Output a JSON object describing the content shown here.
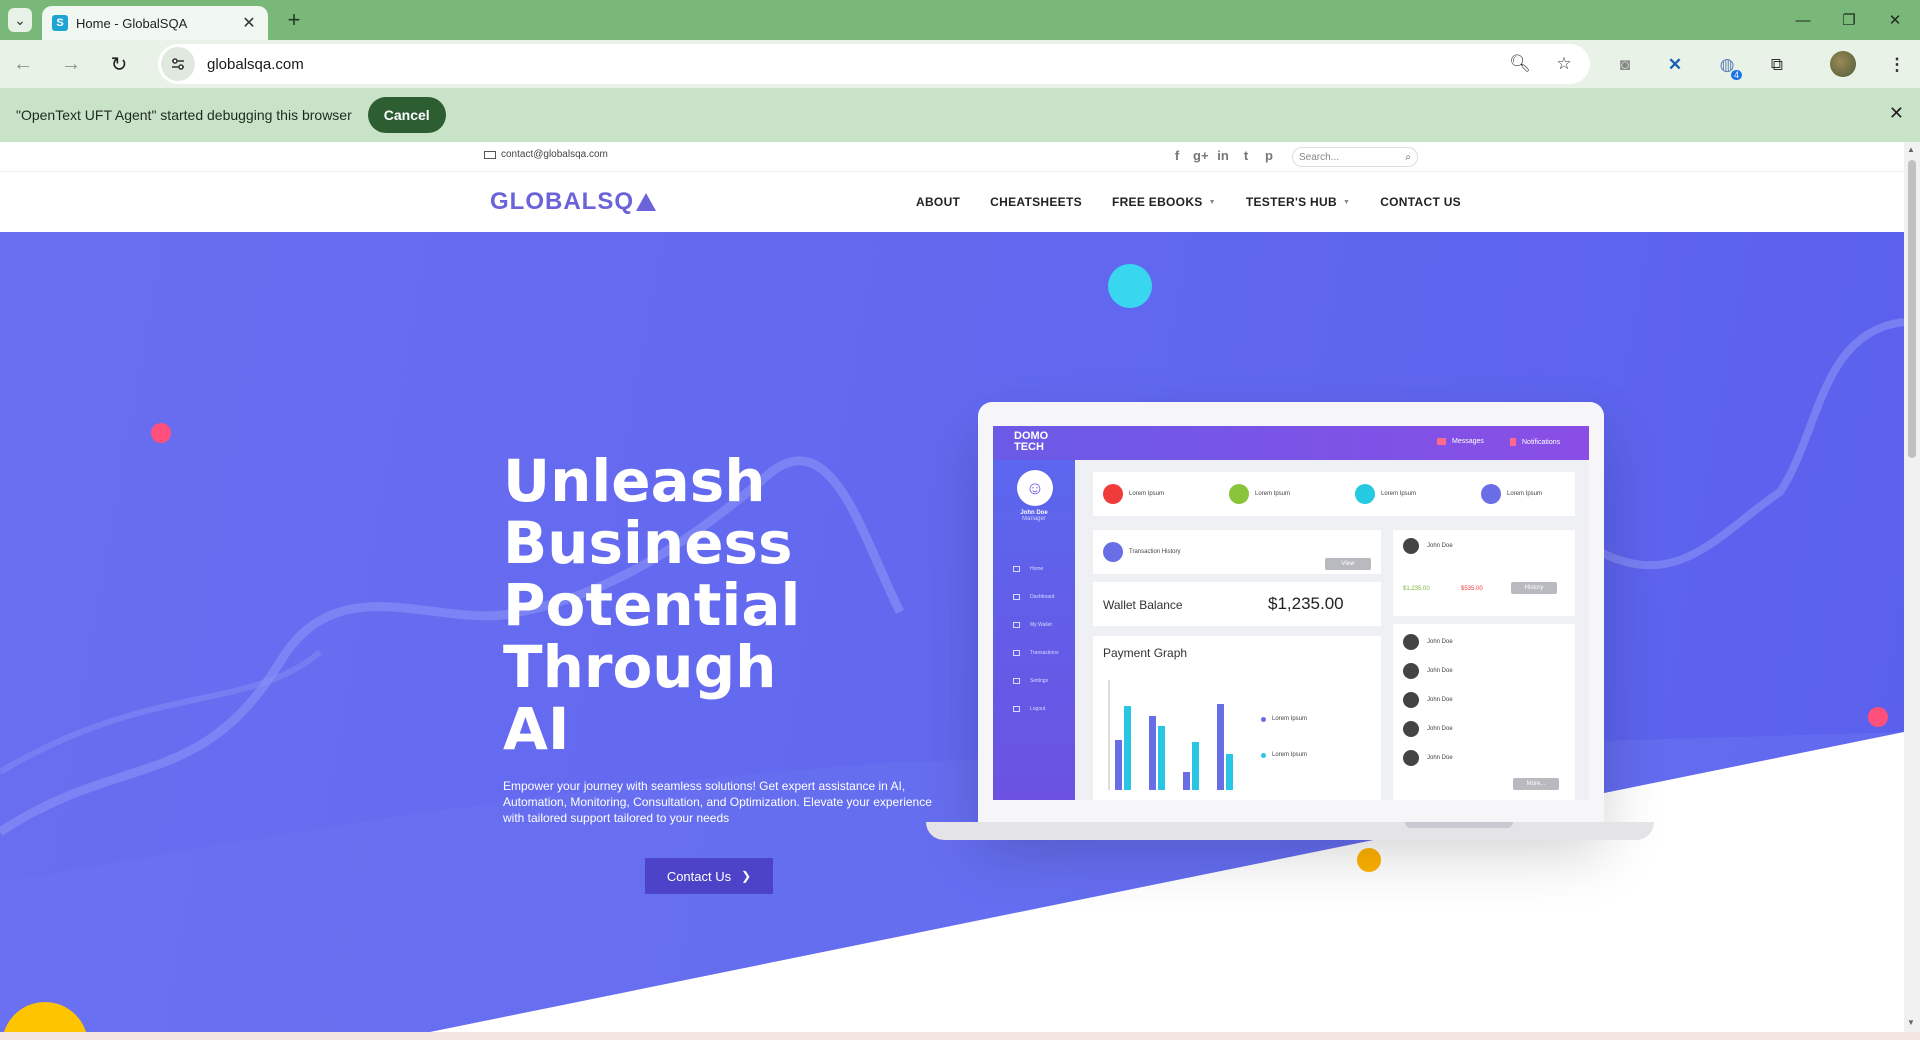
{
  "browser": {
    "tab_title": "Home - GlobalSQA",
    "favicon_letter": "S",
    "url": "globalsqa.com",
    "extension_badge": "4",
    "infobar_text": "\"OpenText UFT Agent\" started debugging this browser",
    "infobar_cancel": "Cancel"
  },
  "site": {
    "contact_email": "contact@globalsqa.com",
    "socials": [
      "f",
      "g+",
      "in",
      "t",
      "p"
    ],
    "search_placeholder": "Search...",
    "logo": "GLOBALSQ",
    "menu": [
      {
        "label": "ABOUT",
        "dropdown": false
      },
      {
        "label": "CHEATSHEETS",
        "dropdown": false
      },
      {
        "label": "FREE EBOOKS",
        "dropdown": true
      },
      {
        "label": "TESTER'S HUB",
        "dropdown": true
      },
      {
        "label": "CONTACT US",
        "dropdown": false
      }
    ]
  },
  "hero": {
    "title_lines": [
      "Unleash",
      "Business",
      "Potential",
      "Through",
      "AI"
    ],
    "description": "Empower your journey with seamless solutions! Get expert assistance in AI, Automation, Monitoring, Consultation, and Optimization. Elevate your experience with tailored support tailored to your needs",
    "cta": "Contact Us",
    "colors": {
      "hero_bg": "#6168ef",
      "cta_bg": "#4c43c8",
      "dot_pink": "#ff4f7b",
      "dot_cyan": "#38d6ef",
      "dot_yellow": "#ffb300"
    }
  },
  "dashboard": {
    "logo_line1": "DOMO",
    "logo_line2": "TECH",
    "messages": "Messages",
    "notifications": "Notifications",
    "user_name": "John Doe",
    "user_role": "Manager",
    "nav": [
      "Home",
      "Dashboard",
      "My Wallet",
      "Transactions",
      "Settings",
      "Logout"
    ],
    "lorem": "Lorem Ipsum",
    "transaction_history": "Transaction History",
    "view": "View",
    "wallet_label": "Wallet Balance",
    "wallet_value": "$1,235.00",
    "payment_graph": "Payment Graph",
    "in_amount": "$1,235.00",
    "out_amount": "$535.00",
    "history": "History",
    "more": "More...",
    "person": "John Doe"
  }
}
